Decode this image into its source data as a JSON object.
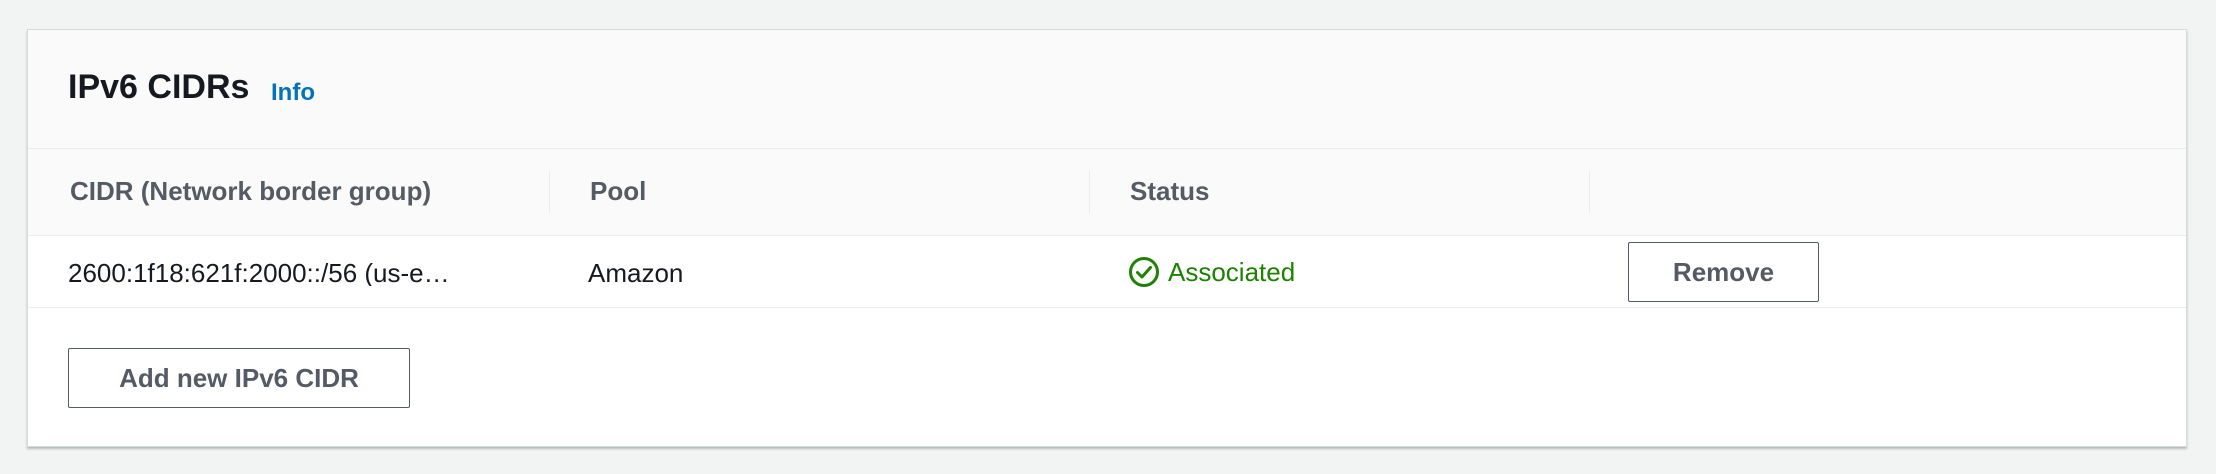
{
  "header": {
    "title": "IPv6 CIDRs",
    "info_label": "Info"
  },
  "table": {
    "columns": [
      "CIDR (Network border group)",
      "Pool",
      "Status"
    ],
    "rows": [
      {
        "cidr": "2600:1f18:621f:2000::/56 (us-e…",
        "pool": "Amazon",
        "status": "Associated",
        "status_icon": "check-circle-icon",
        "action_label": "Remove"
      }
    ]
  },
  "actions": {
    "add_label": "Add new IPv6 CIDR"
  },
  "colors": {
    "status_success": "#1d8102",
    "link": "#0073bb",
    "text_primary": "#16191f",
    "text_secondary": "#545b64"
  }
}
